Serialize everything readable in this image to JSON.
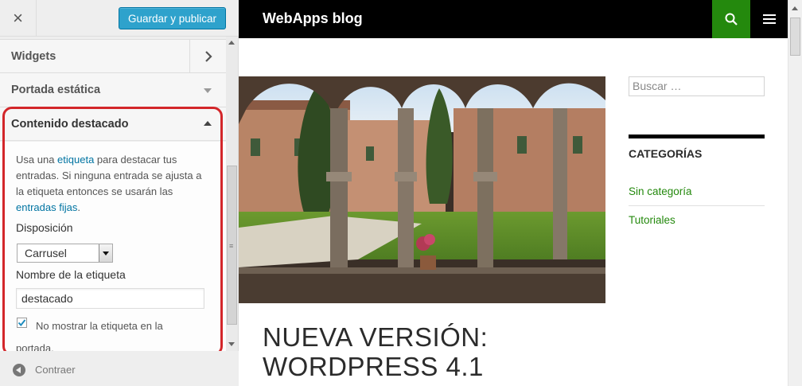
{
  "customizer": {
    "close_icon": "×",
    "publish_label": "Guardar y publicar",
    "sections": {
      "widgets": "Widgets",
      "static_front": "Portada estática",
      "featured": "Contenido destacado"
    },
    "featured_panel": {
      "desc_1": "Usa una ",
      "desc_link_tag": "etiqueta",
      "desc_2": " para destacar tus entradas. Si ninguna entrada se ajusta a la etiqueta entonces se usarán las ",
      "desc_link_sticky": "entradas fijas",
      "desc_3": ".",
      "layout_label": "Disposición",
      "layout_value": "Carrusel",
      "tag_name_label": "Nombre de la etiqueta",
      "tag_name_value": "destacado",
      "hide_tag_checked": true,
      "hide_tag_label": "No mostrar la etiqueta en la portada."
    },
    "collapse_label": "Contraer",
    "highlight_color": "#d3262a",
    "publish_color": "#2ea2cc"
  },
  "preview": {
    "site_title": "WebApps blog",
    "accent_color": "#24890d",
    "post_title": "NUEVA VERSIÓN: WORDPRESS 4.1",
    "search_placeholder": "Buscar …",
    "categories_title": "CATEGORÍAS",
    "categories": [
      "Sin categoría",
      "Tutoriales"
    ]
  },
  "icons": [
    "close-icon",
    "chevron-right-icon",
    "caret-down-icon",
    "caret-up-icon",
    "checkbox-check-icon",
    "collapse-arrow-icon",
    "search-icon",
    "menu-icon"
  ]
}
